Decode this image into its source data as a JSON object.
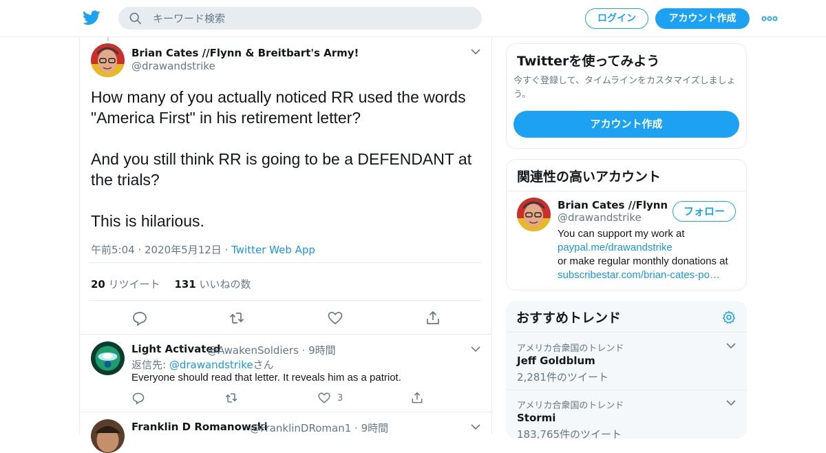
{
  "header": {
    "search_placeholder": "キーワード検索",
    "login_label": "ログイン",
    "signup_label": "アカウント作成"
  },
  "tweet": {
    "name": "Brian Cates //Flynn & Breitbart's Army!",
    "handle": "@drawandstrike",
    "text": [
      "How many of you actually noticed RR used the words",
      "\"America First\" in his retirement letter?",
      "",
      "And you still think RR is going to be a DEFENDANT at",
      "the trials?",
      "",
      "This is hilarious."
    ],
    "time": "午前5:04 · 2020年5月12日 · ",
    "source": "Twitter Web App",
    "retweets": "20",
    "retweets_label": " リツイート",
    "likes": "131",
    "likes_label": " いいねの数"
  },
  "replies": [
    {
      "name": "Light Activated",
      "handle": "@AwakenSoldiers",
      "time": " · 9時間",
      "reply_to_prefix": "返信先: ",
      "reply_to": "@drawandstrike",
      "reply_to_suffix": "さん",
      "text": "Everyone should read that letter.  It reveals him as a patriot.",
      "likes": "3"
    },
    {
      "name": "Franklin D Romanowski",
      "handle": "@FranklinDRoman1",
      "time": " · 9時間"
    }
  ],
  "signup_card": {
    "title": "Twitterを使ってみよう",
    "subtitle": "今すぐ登録して、タイムラインをカスタマイズしましょう。",
    "button": "アカウント作成"
  },
  "related": {
    "title": "関連性の高いアカウント",
    "name": "Brian Cates //Flynn …",
    "handle": "@drawandstrike",
    "follow": "フォロー",
    "bio_1": "You can support my work at",
    "bio_link_1": "paypal.me/drawandstrike",
    "bio_2": " or make regular monthly donations at",
    "bio_link_2": "subscribestar.com/brian-cates-po…"
  },
  "trends": {
    "title": "おすすめトレンド",
    "items": [
      {
        "context": "アメリカ合衆国のトレンド",
        "name": "Jeff Goldblum",
        "count": "2,281件のツイート"
      },
      {
        "context": "アメリカ合衆国のトレンド",
        "name": "Stormi",
        "count": "183,765件のツイート"
      }
    ]
  },
  "colors": {
    "accent": "#1da1f2",
    "link": "#1b95e0",
    "muted": "#657786",
    "border": "#e6ecf0"
  }
}
